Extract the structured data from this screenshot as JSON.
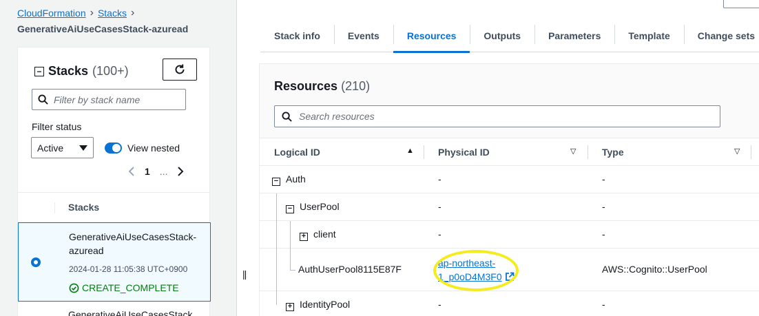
{
  "breadcrumb": {
    "root": "CloudFormation",
    "stacks": "Stacks",
    "current": "GenerativeAiUseCasesStack-azuread"
  },
  "stacks_panel": {
    "title": "Stacks",
    "count": "(100+)",
    "filter_placeholder": "Filter by stack name",
    "filter_status_label": "Filter status",
    "filter_status_value": "Active",
    "view_nested_label": "View nested",
    "view_nested_on": true,
    "page_number": "1",
    "page_ellipsis": "...",
    "table_header": "Stacks",
    "selected_stack": {
      "name": "GenerativeAiUseCasesStack-azuread",
      "timestamp": "2024-01-28 11:05:38 UTC+0900",
      "status": "CREATE_COMPLETE"
    },
    "next_stack_name": "GenerativeAiUseCasesStack"
  },
  "tabs": [
    "Stack info",
    "Events",
    "Resources",
    "Outputs",
    "Parameters",
    "Template",
    "Change sets"
  ],
  "active_tab": "Resources",
  "resources": {
    "title": "Resources",
    "count": "(210)",
    "search_placeholder": "Search resources",
    "columns": {
      "logical_id": "Logical ID",
      "physical_id": "Physical ID",
      "type": "Type"
    },
    "rows": [
      {
        "logical_id": "Auth",
        "physical_id": "-",
        "type": "-"
      },
      {
        "logical_id": "UserPool",
        "physical_id": "-",
        "type": "-"
      },
      {
        "logical_id": "client",
        "physical_id": "-",
        "type": "-"
      },
      {
        "logical_id": "AuthUserPool8115E87F",
        "physical_id_line1": "ap-northeast-",
        "physical_id_line2": "1_p0oD4M3F0",
        "type": "AWS::Cognito::UserPool"
      },
      {
        "logical_id": "IdentityPool",
        "physical_id": "-",
        "type": "-"
      }
    ]
  },
  "colors": {
    "accent": "#0972d3",
    "success": "#037f0c",
    "highlight": "#f5ec1d"
  }
}
